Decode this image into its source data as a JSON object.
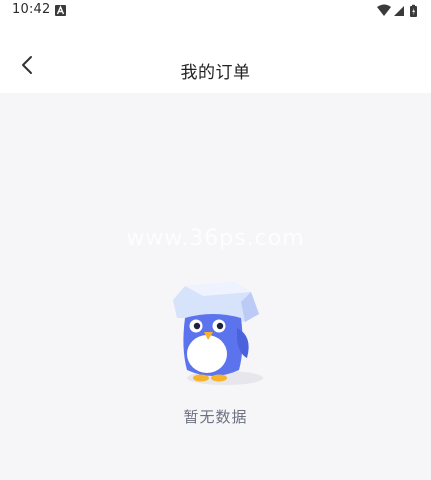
{
  "status_bar": {
    "time": "10:42",
    "notification_icon": "a-icon",
    "icons": [
      "wifi-icon",
      "signal-icon",
      "battery-icon"
    ]
  },
  "app_bar": {
    "back_icon": "chevron-left-icon",
    "title": "我的订单"
  },
  "main": {
    "watermark": "www.36ps.com",
    "empty_state": {
      "illustration": "penguin-mascot-icon",
      "text": "暂无数据"
    }
  },
  "colors": {
    "background": "#f6f6f8",
    "mascot_blue": "#5b74ee",
    "text_secondary": "#6d7080"
  }
}
